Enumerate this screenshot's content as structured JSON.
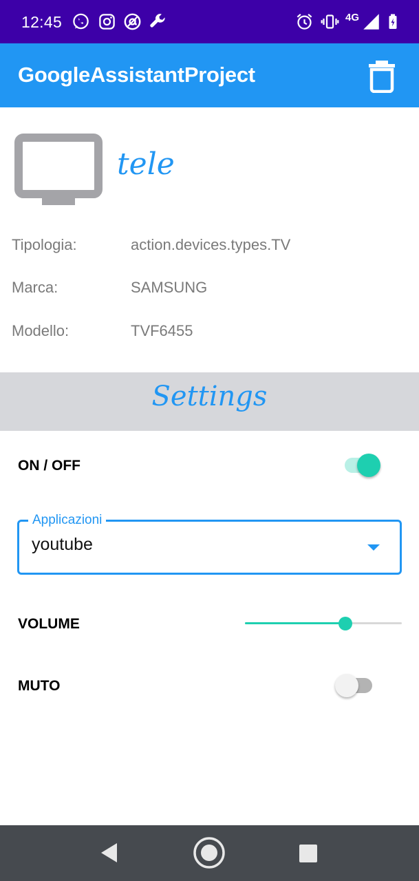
{
  "status_bar": {
    "time": "12:45",
    "network": "4G",
    "left_icons": [
      "whatsapp-icon",
      "instagram-icon",
      "at-sign-icon",
      "wrench-icon"
    ],
    "right_icons": [
      "alarm-icon",
      "vibrate-icon",
      "signal-icon",
      "battery-charging-icon"
    ]
  },
  "app_bar": {
    "title": "GoogleAssistantProject",
    "action_icon": "trash-icon"
  },
  "device": {
    "icon": "tv-icon",
    "name": "tele",
    "info": [
      {
        "label": "Tipologia:",
        "value": "action.devices.types.TV"
      },
      {
        "label": "Marca:",
        "value": "SAMSUNG"
      },
      {
        "label": "Modello:",
        "value": "TVF6455"
      }
    ]
  },
  "settings": {
    "title": "Settings",
    "power": {
      "label": "ON / OFF",
      "checked": true
    },
    "applications": {
      "label": "Applicazioni",
      "value": "youtube"
    },
    "volume": {
      "label": "VOLUME",
      "fraction": 0.64
    },
    "mute": {
      "label": "MUTO",
      "checked": false
    }
  },
  "colors": {
    "status_bar": "#3d00a8",
    "app_bar": "#2196f3",
    "accent": "#1ecfb0",
    "settings_band": "#d6d7db",
    "nav_bar": "#464a4f"
  },
  "nav_bar": {
    "buttons": [
      "back-icon",
      "home-icon",
      "recents-icon"
    ]
  }
}
